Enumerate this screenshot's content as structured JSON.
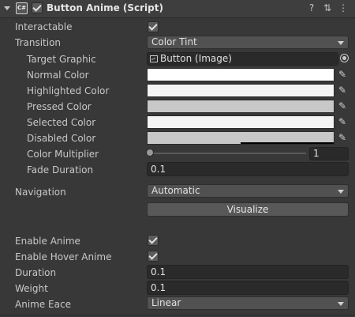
{
  "component": {
    "title": "Button Anime (Script)",
    "script_icon": "C#",
    "help_icon": "?",
    "presets_icon": "⇅",
    "menu_icon": "⋮"
  },
  "fields": {
    "interactable": {
      "label": "Interactable",
      "checked": true
    },
    "transition": {
      "label": "Transition",
      "value": "Color Tint"
    },
    "target_graphic": {
      "label": "Target Graphic",
      "value": "Button (Image)"
    },
    "normal_color": {
      "label": "Normal Color",
      "color": "#ffffff"
    },
    "highlighted_color": {
      "label": "Highlighted Color",
      "color": "#f5f5f5"
    },
    "pressed_color": {
      "label": "Pressed Color",
      "color": "#c8c8c8"
    },
    "selected_color": {
      "label": "Selected Color",
      "color": "#f5f5f5"
    },
    "disabled_color": {
      "label": "Disabled Color",
      "color": "#c8c8c8",
      "alpha": 0.5
    },
    "color_multiplier": {
      "label": "Color Multiplier",
      "value": "1",
      "slider_fraction": 0
    },
    "fade_duration": {
      "label": "Fade Duration",
      "value": "0.1"
    },
    "navigation": {
      "label": "Navigation",
      "value": "Automatic"
    },
    "visualize": {
      "label": "Visualize"
    },
    "enable_anime": {
      "label": "Enable Anime",
      "checked": true
    },
    "enable_hover_anime": {
      "label": "Enable Hover Anime",
      "checked": true
    },
    "duration": {
      "label": "Duration",
      "value": "0.1"
    },
    "weight": {
      "label": "Weight",
      "value": "0.1"
    },
    "anime_eace": {
      "label": "Anime Eace",
      "value": "Linear"
    }
  }
}
